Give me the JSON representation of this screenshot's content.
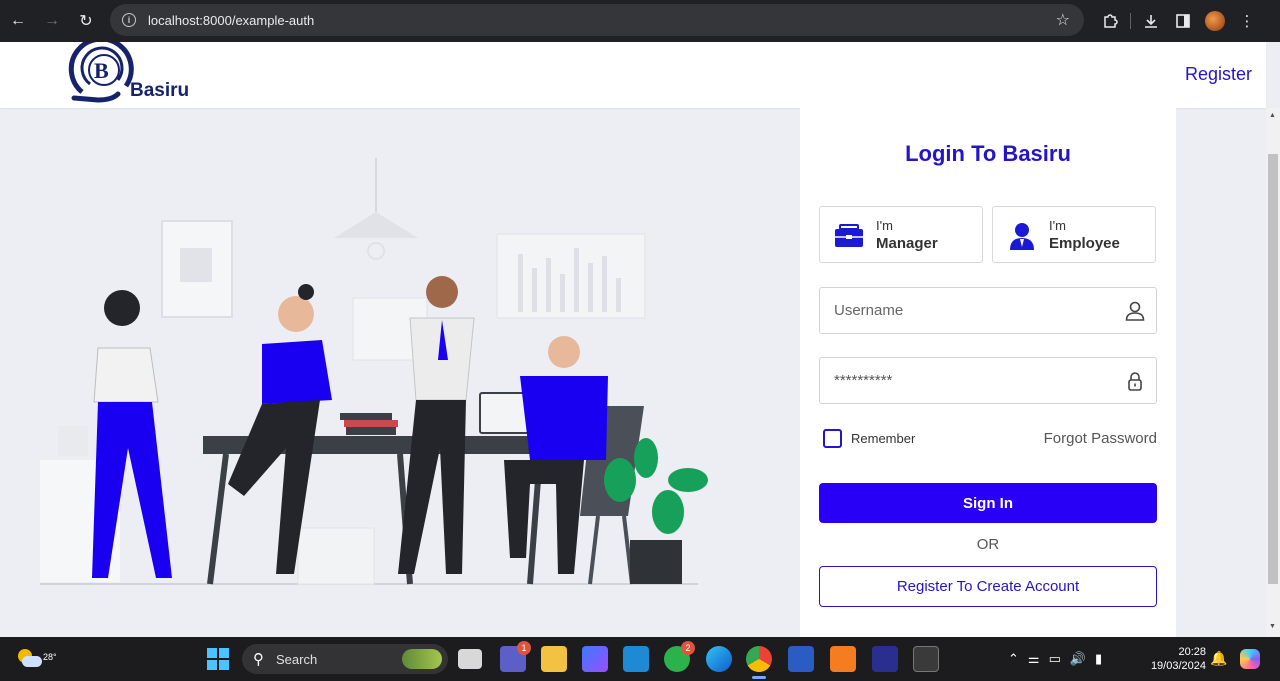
{
  "browser": {
    "url": "localhost:8000/example-auth"
  },
  "header": {
    "logo_text": "Basiru",
    "logo_letter": "B",
    "register_link": "Register"
  },
  "login": {
    "title": "Login To Basiru",
    "roles": [
      {
        "small": "I'm",
        "big": "Manager"
      },
      {
        "small": "I'm",
        "big": "Employee"
      }
    ],
    "username_placeholder": "Username",
    "password_value": "**********",
    "remember_label": "Remember",
    "forgot_label": "Forgot Password",
    "signin_label": "Sign In",
    "or_label": "OR",
    "register_label": "Register To Create Account"
  },
  "taskbar": {
    "temperature": "28°",
    "search_label": "Search",
    "teams_badge": "1",
    "whatsapp_badge": "2",
    "time": "20:28",
    "date": "19/03/2024"
  },
  "colors": {
    "brand": "#2415c9",
    "button": "#2900f5",
    "page_bg": "#eceef3"
  }
}
